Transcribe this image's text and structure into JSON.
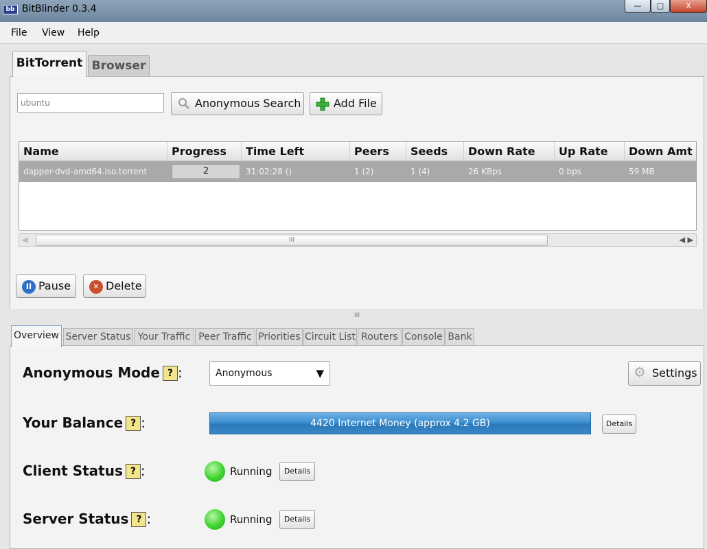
{
  "window": {
    "app_icon": "bb",
    "title": "BitBlinder 0.3.4",
    "controls": {
      "minimize": "—",
      "maximize": "□",
      "close": "X"
    }
  },
  "menu": [
    "File",
    "View",
    "Help"
  ],
  "top_tabs": [
    {
      "label": "BitTorrent",
      "active": true
    },
    {
      "label": "Browser",
      "active": false
    }
  ],
  "search": {
    "value": "ubuntu",
    "anon_search_label": "Anonymous Search",
    "anon_search_icon": "magnifier-icon",
    "add_file_label": "Add File",
    "add_file_icon": "green-plus-icon"
  },
  "torrent_table": {
    "columns": [
      "Name",
      "Progress",
      "Time Left",
      "Peers",
      "Seeds",
      "Down Rate",
      "Up Rate",
      "Down Amt"
    ],
    "rows": [
      {
        "name": "dapper-dvd-amd64.iso.torrent",
        "progress": "2",
        "time_left": "31:02:28 ()",
        "peers": "1 (2)",
        "seeds": "1 (4)",
        "down_rate": "26 KBps",
        "up_rate": "0 bps",
        "down_amt": "59 MB"
      }
    ],
    "scroll_grip": "III",
    "scroll_left": "◀",
    "scroll_right": "◀ ▶"
  },
  "actions": {
    "pause_label": "Pause",
    "pause_glyph": "II",
    "delete_label": "Delete",
    "delete_glyph": "✕"
  },
  "splitter_grip": "III",
  "bottom_tabs": [
    "Overview",
    "Server Status",
    "Your Traffic",
    "Peer Traffic",
    "Priorities",
    "Circuit List",
    "Routers",
    "Console",
    "Bank"
  ],
  "overview": {
    "help_mark": "?",
    "colon": ":",
    "anonymous_mode": {
      "label": "Anonymous Mode",
      "selected": "Anonymous",
      "arrow": "▼"
    },
    "settings_label": "Settings",
    "balance": {
      "label": "Your Balance",
      "text": "4420 Internet Money (approx 4.2 GB)",
      "details_label": "Details"
    },
    "client_status": {
      "label": "Client Status",
      "status": "Running",
      "details_label": "Details"
    },
    "server_status": {
      "label": "Server Status",
      "status": "Running",
      "details_label": "Details"
    }
  },
  "colors": {
    "selected_row": "#a9a9a9",
    "balance_bar": "#3c8fd0",
    "status_running": "#3fd42f",
    "help_badge": "#f3e58a"
  }
}
